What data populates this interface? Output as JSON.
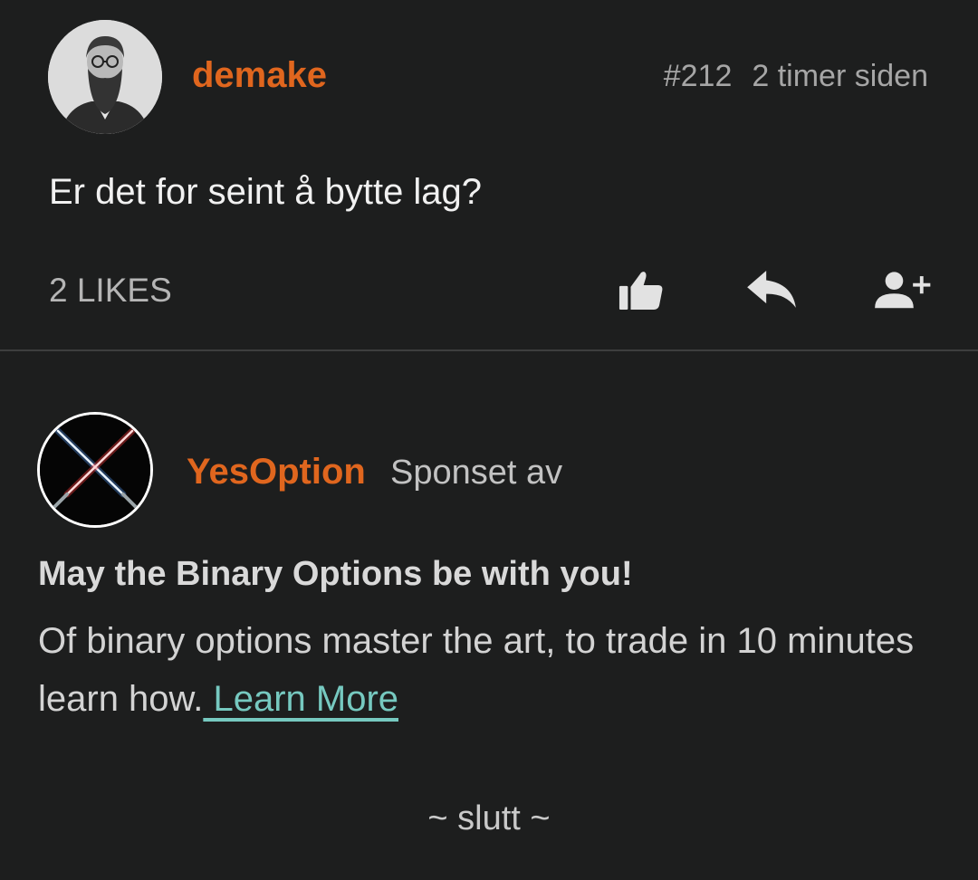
{
  "post": {
    "username": "demake",
    "post_number": "#212",
    "timestamp": "2 timer siden",
    "text": "Er det for seint å bytte lag?",
    "likes": "2 LIKES",
    "actions": [
      "thumbs-up-icon",
      "reply-icon",
      "add-user-icon"
    ]
  },
  "ad": {
    "advertiser": "YesOption",
    "sponsored_label": "Sponset av",
    "title": "May the Binary Options be with you!",
    "body": "Of binary options master the art, to trade in 10 minutes learn how.",
    "link_text": " Learn More ",
    "link_color": "#76c9c0"
  },
  "footer": {
    "end_text": "~ slutt ~"
  },
  "colors": {
    "background": "#1d1e1e",
    "accent": "#e0661e",
    "muted": "#a6a6a6"
  }
}
